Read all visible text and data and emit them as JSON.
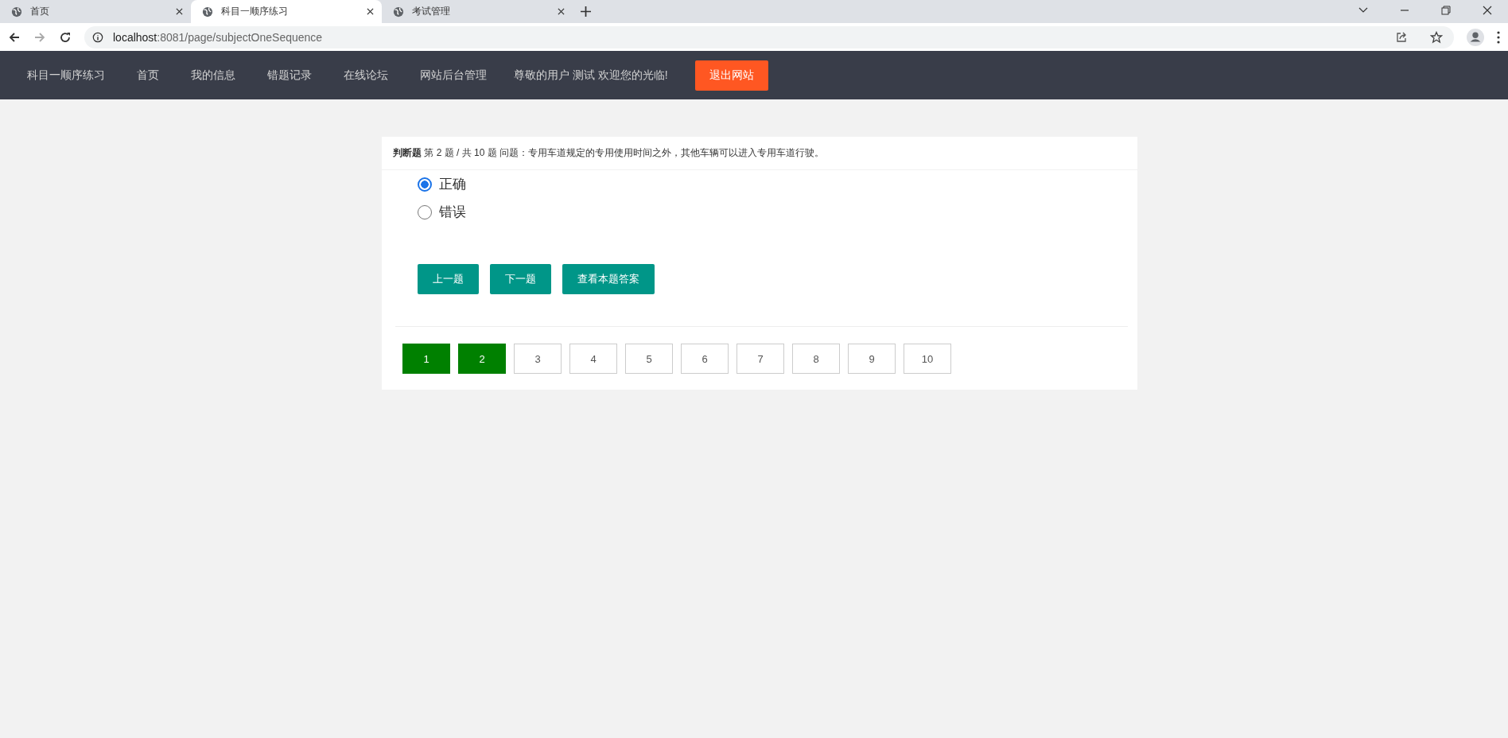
{
  "browser": {
    "tabs": [
      {
        "title": "首页",
        "selected": false
      },
      {
        "title": "科目一顺序练习",
        "selected": true
      },
      {
        "title": "考试管理",
        "selected": false
      }
    ],
    "url_host": "localhost",
    "url_rest": ":8081/page/subjectOneSequence"
  },
  "navbar": {
    "items": [
      "科目一顺序练习",
      "首页",
      "我的信息",
      "错题记录",
      "在线论坛",
      "网站后台管理"
    ],
    "greeting": "尊敬的用户 测试 欢迎您的光临!",
    "logout": "退出网站"
  },
  "question": {
    "type": "判断题",
    "progress": "第 2 题 / 共 10 题",
    "text": "问题：专用车道规定的专用使用时间之外，其他车辆可以进入专用车道行驶。",
    "options": [
      {
        "label": "正确",
        "selected": true
      },
      {
        "label": "错误",
        "selected": false
      }
    ],
    "buttons": [
      "上一题",
      "下一题",
      "查看本题答案"
    ],
    "pages": [
      {
        "label": "1",
        "answered": true
      },
      {
        "label": "2",
        "answered": true
      },
      {
        "label": "3",
        "answered": false
      },
      {
        "label": "4",
        "answered": false
      },
      {
        "label": "5",
        "answered": false
      },
      {
        "label": "6",
        "answered": false
      },
      {
        "label": "7",
        "answered": false
      },
      {
        "label": "8",
        "answered": false
      },
      {
        "label": "9",
        "answered": false
      },
      {
        "label": "10",
        "answered": false
      }
    ]
  }
}
